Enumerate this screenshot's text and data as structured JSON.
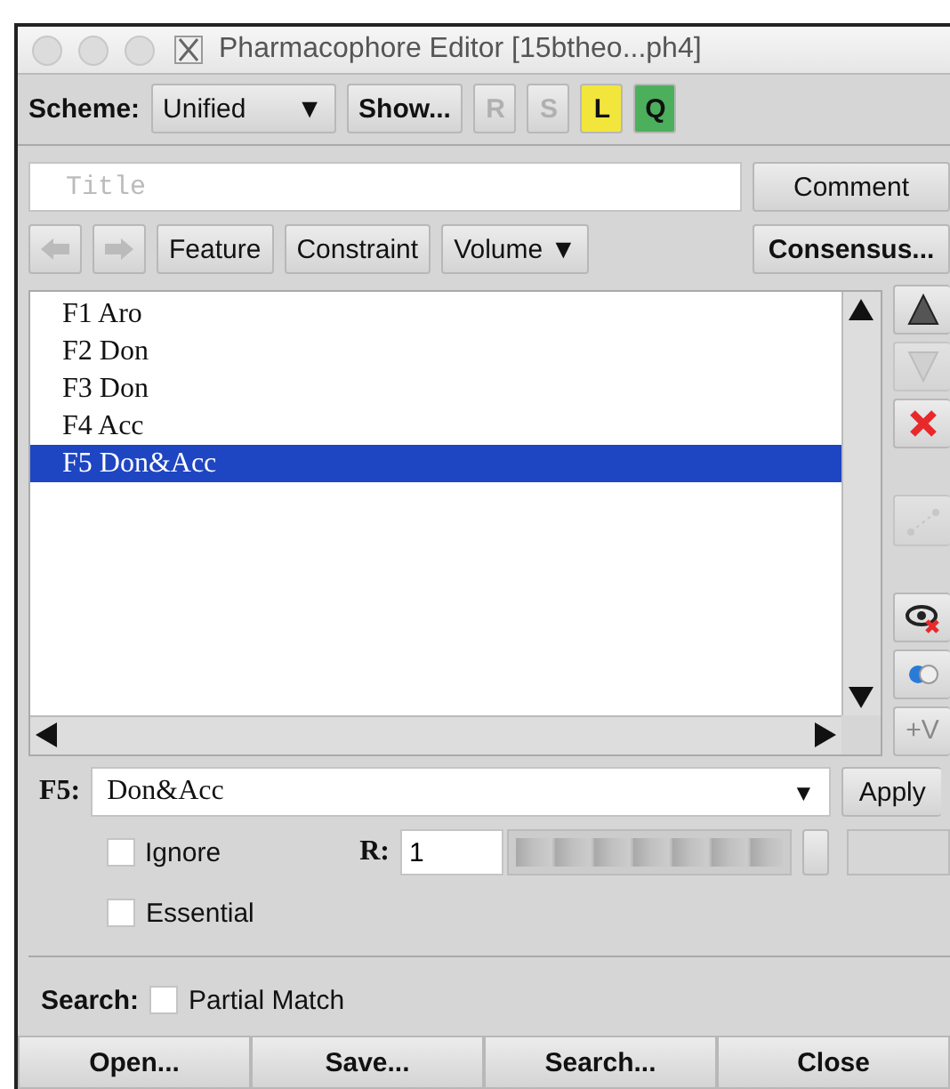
{
  "window": {
    "title": "Pharmacophore Editor [15btheo...ph4]"
  },
  "toolbar": {
    "scheme_label": "Scheme:",
    "scheme_value": "Unified",
    "scheme_arrow": "▼",
    "show_button": "Show...",
    "tool_buttons": [
      {
        "label": "R",
        "disabled": true
      },
      {
        "label": "S",
        "disabled": true
      },
      {
        "label": "L",
        "disabled": false,
        "color": "#f2e53c"
      },
      {
        "label": "Q",
        "disabled": false,
        "color": "#4caf5c"
      }
    ]
  },
  "title_field": {
    "placeholder": "Title"
  },
  "comment_button": "Comment",
  "nav": {
    "back_disabled": true,
    "forward_disabled": true,
    "buttons": [
      "Feature",
      "Constraint"
    ],
    "volume_menu": "Volume ▼",
    "consensus_button": "Consensus..."
  },
  "features": [
    {
      "label": "F1 Aro",
      "selected": false
    },
    {
      "label": "F2 Don",
      "selected": false
    },
    {
      "label": "F3 Don",
      "selected": false
    },
    {
      "label": "F4 Acc",
      "selected": false
    },
    {
      "label": "F5 Don&Acc",
      "selected": true
    }
  ],
  "side_tools": [
    {
      "kind": "up",
      "disabled": false
    },
    {
      "kind": "down",
      "disabled": true
    },
    {
      "kind": "delete",
      "disabled": false
    },
    {
      "kind": "link",
      "disabled": true
    },
    {
      "kind": "hide",
      "disabled": false
    },
    {
      "kind": "merge",
      "disabled": false
    },
    {
      "kind": "volume",
      "label": "+V",
      "disabled": true
    }
  ],
  "editor": {
    "feature_label": "F5:",
    "expression": "Don&Acc",
    "expression_arrow": "▼",
    "apply_button": "Apply",
    "radius_label": "R:",
    "radius_value": "1",
    "radius_slider": {
      "disabled": true
    },
    "options": [
      {
        "label": "Ignore",
        "checked": false
      },
      {
        "label": "Essential",
        "checked": false
      }
    ]
  },
  "search": {
    "label": "Search:",
    "option": {
      "label": "Partial Match",
      "checked": false
    }
  },
  "buttons": [
    "Open...",
    "Save...",
    "Search...",
    "Close"
  ]
}
